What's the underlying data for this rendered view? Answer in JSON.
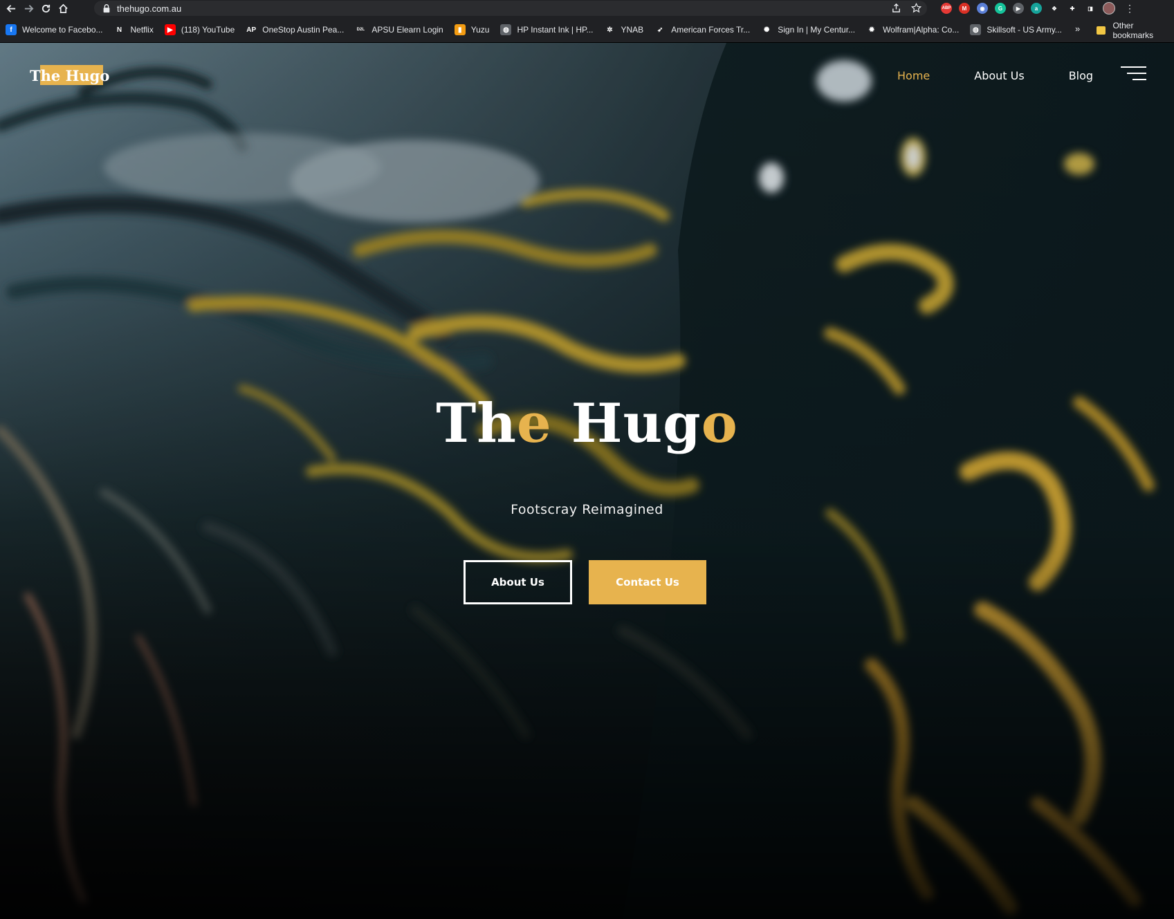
{
  "browser": {
    "url": "thehugo.com.au",
    "bookmarks": [
      {
        "label": "Welcome to Facebo...",
        "icon": "facebook-icon",
        "color": "#1877f2",
        "glyph": "f"
      },
      {
        "label": "Netflix",
        "icon": "netflix-icon",
        "color": "#202124",
        "glyph": "N"
      },
      {
        "label": "(118) YouTube",
        "icon": "youtube-icon",
        "color": "#ff0000",
        "glyph": "▶"
      },
      {
        "label": "OneStop Austin Pea...",
        "icon": "onestop-icon",
        "color": "#202124",
        "glyph": "AP"
      },
      {
        "label": "APSU Elearn Login",
        "icon": "d2l-icon",
        "color": "#202124",
        "glyph": "D2L"
      },
      {
        "label": "Yuzu",
        "icon": "yuzu-icon",
        "color": "#f39c12",
        "glyph": "▮"
      },
      {
        "label": "HP Instant Ink | HP...",
        "icon": "globe-icon",
        "color": "#5f6368",
        "glyph": "◍"
      },
      {
        "label": "YNAB",
        "icon": "ynab-icon",
        "color": "#202124",
        "glyph": "✲"
      },
      {
        "label": "American Forces Tr...",
        "icon": "aft-icon",
        "color": "#202124",
        "glyph": "➶"
      },
      {
        "label": "Sign In | My Centur...",
        "icon": "century-icon",
        "color": "#202124",
        "glyph": "✺"
      },
      {
        "label": "Wolfram|Alpha: Co...",
        "icon": "wolfram-icon",
        "color": "#202124",
        "glyph": "✹"
      },
      {
        "label": "Skillsoft - US Army...",
        "icon": "globe-icon",
        "color": "#5f6368",
        "glyph": "◍"
      }
    ],
    "more_bookmarks": "»",
    "other_bookmarks": "Other bookmarks",
    "extensions": [
      {
        "name": "adblock-icon",
        "color": "#e53935",
        "glyph": "ABP"
      },
      {
        "name": "gmail-icon",
        "color": "#d93025",
        "glyph": "M"
      },
      {
        "name": "camera-icon",
        "color": "#5b7fd6",
        "glyph": "◉"
      },
      {
        "name": "grammarly-icon",
        "color": "#15c39a",
        "glyph": "G"
      },
      {
        "name": "play-icon",
        "color": "#5f6368",
        "glyph": "▶"
      },
      {
        "name": "amazon-assistant-icon",
        "color": "#16a39a",
        "glyph": "a"
      },
      {
        "name": "dropbox-icon",
        "color": "#202124",
        "glyph": "✥"
      },
      {
        "name": "puzzle-icon",
        "color": "#202124",
        "glyph": "✚"
      },
      {
        "name": "sidepanel-icon",
        "color": "#202124",
        "glyph": "◨"
      }
    ]
  },
  "site": {
    "logo": "The Hugo",
    "nav": [
      {
        "label": "Home",
        "active": true
      },
      {
        "label": "About Us",
        "active": false
      },
      {
        "label": "Blog",
        "active": false
      }
    ],
    "hero": {
      "title_parts": [
        "Th",
        "e",
        " Hug",
        "o"
      ],
      "subtitle": "Footscray Reimagined",
      "primary_button": "About Us",
      "secondary_button": "Contact Us"
    },
    "colors": {
      "accent": "#e7b34e",
      "text": "#ffffff"
    }
  }
}
